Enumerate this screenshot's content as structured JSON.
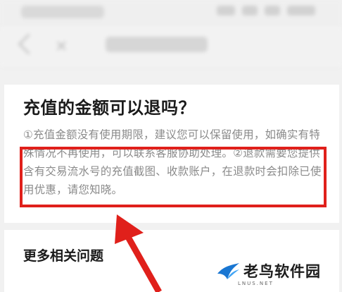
{
  "question": {
    "title": "充值的金额可以退吗？",
    "answer": "①充值金额没有使用期限，建议您可以保留使用，如确实有特殊情况不再使用，可以联系客服协助处理。②退款需要您提供含有交易流水号的充值截图、收款账户，在退款时会扣除已使用优惠，请您知晓。"
  },
  "more": {
    "title": "更多相关问题"
  },
  "watermark": {
    "text": "老鸟软件园",
    "sub": "LNUS.NET"
  },
  "colors": {
    "annotation": "#e0201b"
  }
}
